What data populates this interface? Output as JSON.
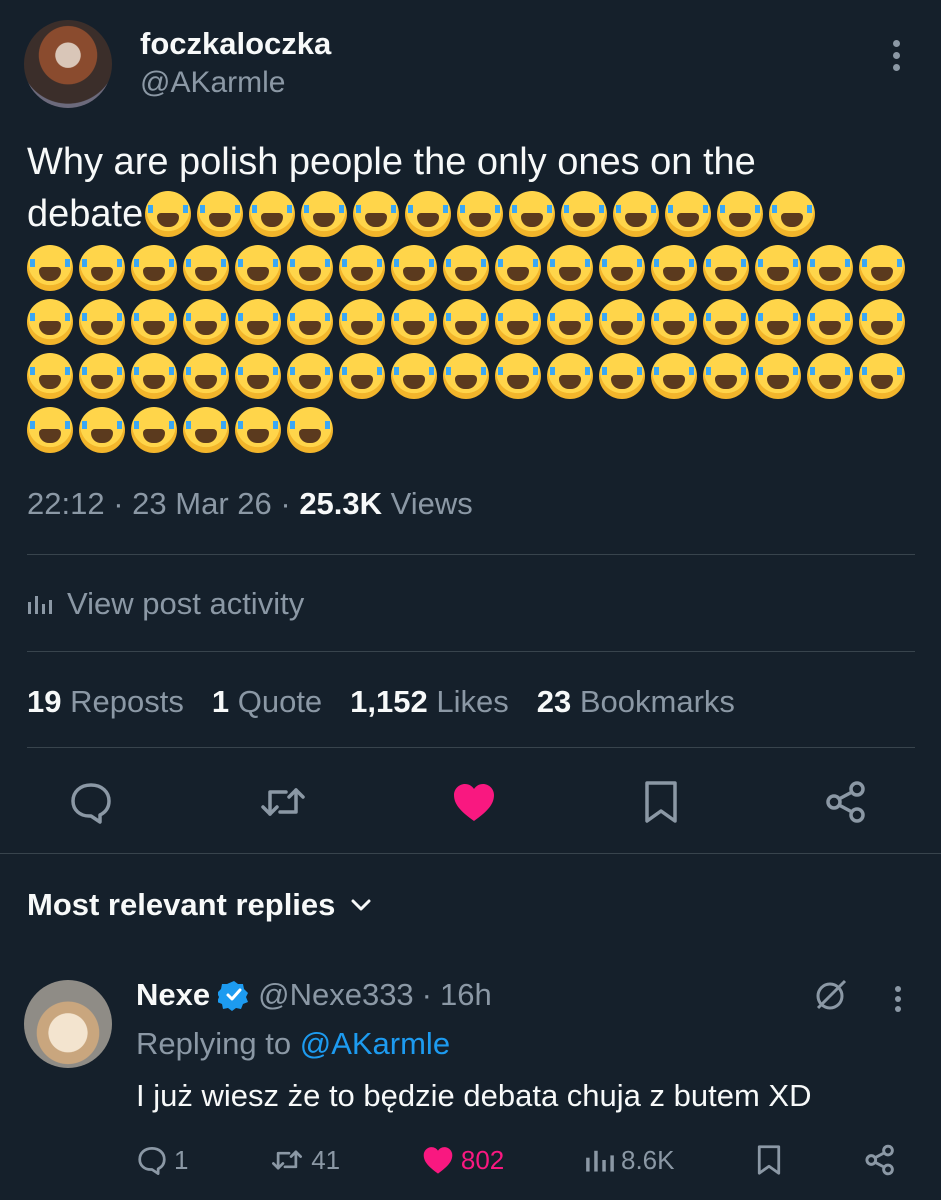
{
  "post": {
    "display_name": "foczkaloczka",
    "handle": "@AKarmle",
    "text": "Why are polish people the only ones on the",
    "text_line2": "debate",
    "emoji_name": "loudly-crying-face",
    "emoji_counts_per_row": [
      13,
      17,
      17,
      17,
      6
    ],
    "time": "22:12",
    "date": "23 Mar 26",
    "views_count": "25.3K",
    "views_label": "Views",
    "sep": "·"
  },
  "activity": {
    "label": "View post activity"
  },
  "stats": {
    "reposts_count": "19",
    "reposts_label": "Reposts",
    "quotes_count": "1",
    "quotes_label": "Quote",
    "likes_count": "1,152",
    "likes_label": "Likes",
    "bookmarks_count": "23",
    "bookmarks_label": "Bookmarks"
  },
  "colors": {
    "background": "#15202b",
    "secondary_text": "#8b98a5",
    "accent": "#1d9bf0",
    "like": "#f91880"
  },
  "replies_section": {
    "title": "Most relevant replies"
  },
  "reply": {
    "display_name": "Nexe",
    "handle": "@Nexe333",
    "sep": "·",
    "time": "16h",
    "replying_prefix": "Replying to",
    "replying_handle": "@AKarmle",
    "text": "I już wiesz że to będzie debata chuja z butem XD",
    "comments": "1",
    "reposts": "41",
    "likes": "802",
    "views": "8.6K"
  }
}
